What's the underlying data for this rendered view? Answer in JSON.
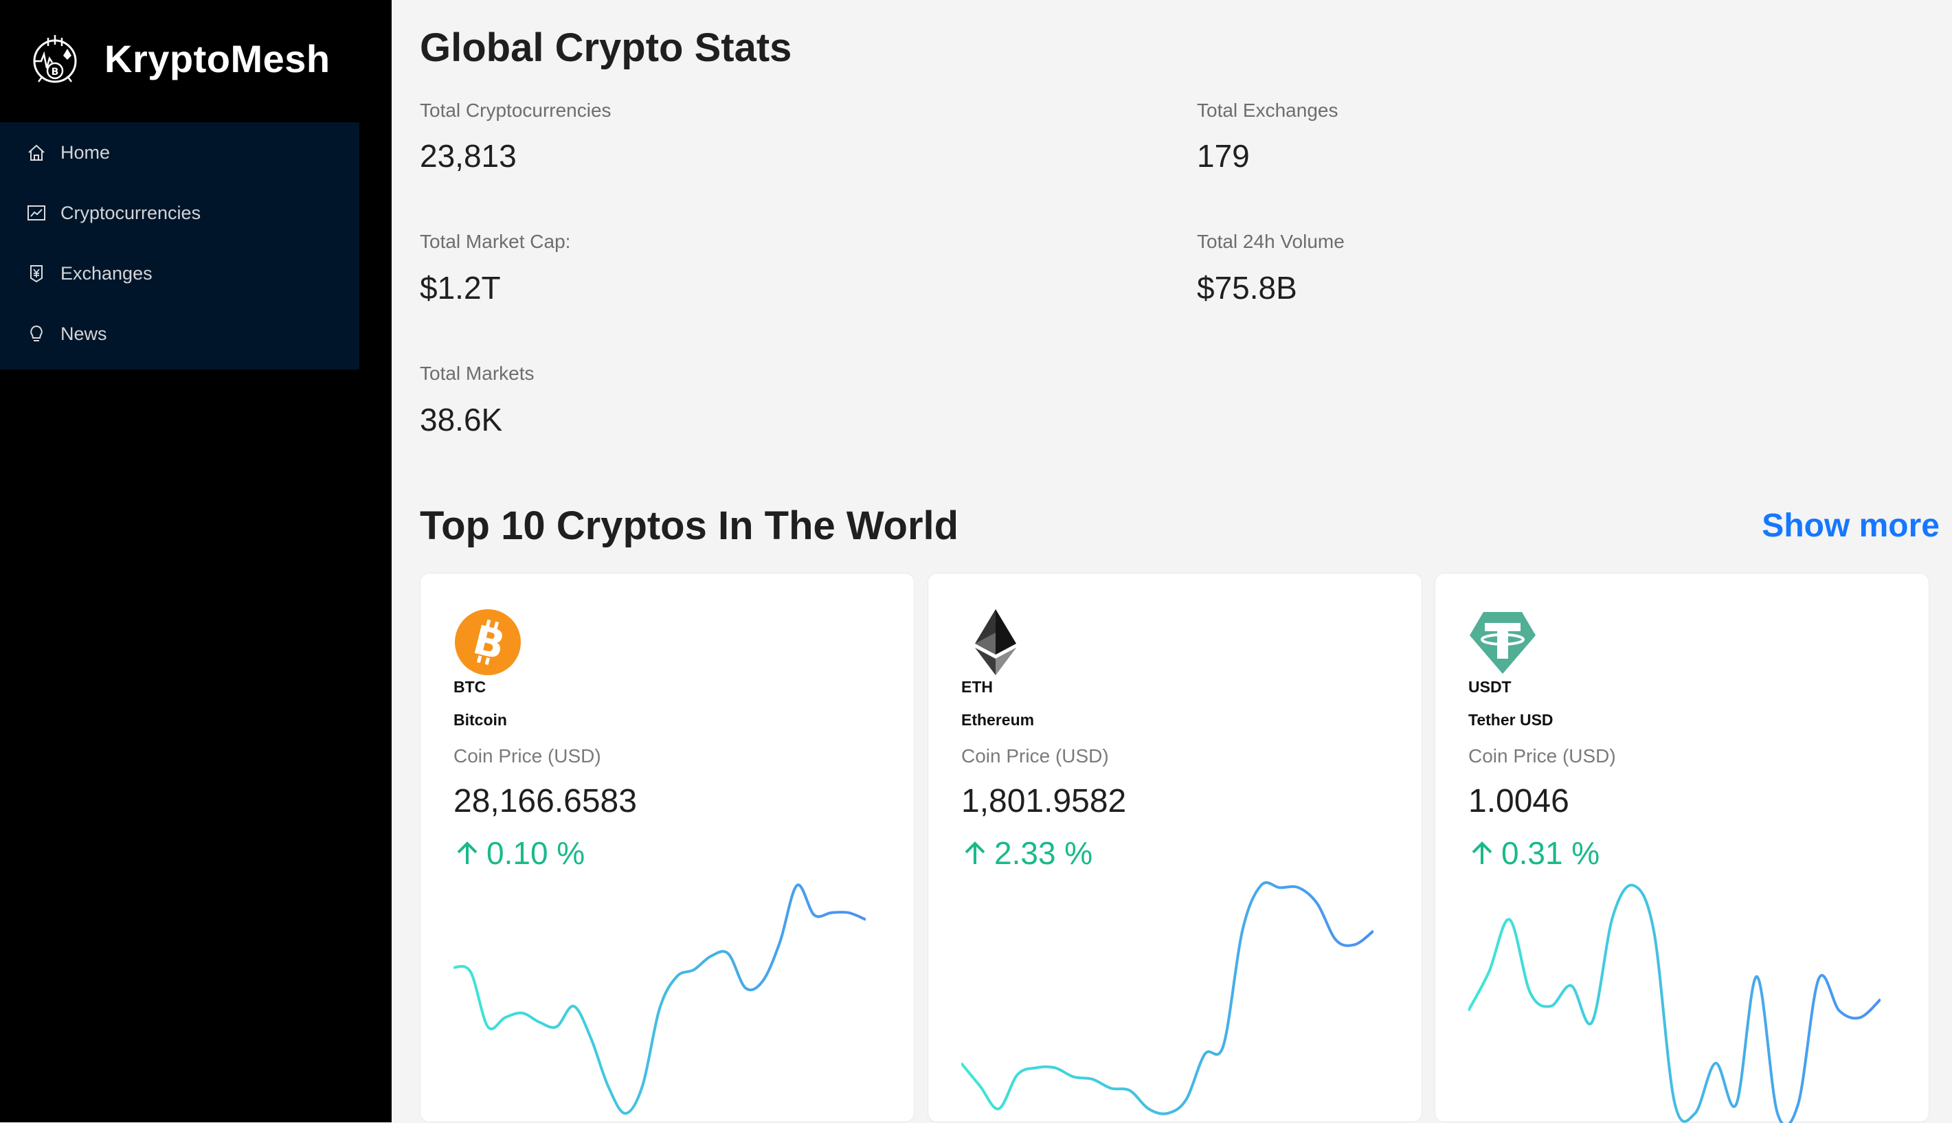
{
  "brand": {
    "name": "KryptoMesh",
    "logo_icon": "crypto-mesh-logo-icon"
  },
  "sidebar": {
    "items": [
      {
        "label": "Home",
        "icon": "home-icon"
      },
      {
        "label": "Cryptocurrencies",
        "icon": "line-chart-icon"
      },
      {
        "label": "Exchanges",
        "icon": "money-collect-icon"
      },
      {
        "label": "News",
        "icon": "bulb-icon"
      }
    ]
  },
  "stats": {
    "title": "Global Crypto Stats",
    "total_cryptocurrencies": {
      "label": "Total Cryptocurrencies",
      "value": "23,813"
    },
    "total_exchanges": {
      "label": "Total Exchanges",
      "value": "179"
    },
    "total_market_cap": {
      "label": "Total Market Cap:",
      "value": "$1.2T"
    },
    "total_24h_volume": {
      "label": "Total 24h Volume",
      "value": "$75.8B"
    },
    "total_markets": {
      "label": "Total Markets",
      "value": "38.6K"
    }
  },
  "top": {
    "title": "Top 10 Cryptos In The World",
    "show_more": "Show more",
    "coins": [
      {
        "symbol": "BTC",
        "name": "Bitcoin",
        "price_label": "Coin Price (USD)",
        "price": "28,166.6583",
        "change": "0.10 %",
        "icon": "bitcoin-icon",
        "sparkline": [
          0.64,
          0.62,
          0.38,
          0.42,
          0.44,
          0.4,
          0.38,
          0.47,
          0.33,
          0.12,
          0.0,
          0.12,
          0.46,
          0.6,
          0.63,
          0.69,
          0.7,
          0.55,
          0.58,
          0.75,
          1.0,
          0.87,
          0.88,
          0.88,
          0.85
        ]
      },
      {
        "symbol": "ETH",
        "name": "Ethereum",
        "price_label": "Coin Price (USD)",
        "price": "1,801.9582",
        "change": "2.33 %",
        "icon": "ethereum-icon",
        "sparkline": [
          0.22,
          0.12,
          0.02,
          0.17,
          0.2,
          0.2,
          0.16,
          0.15,
          0.11,
          0.1,
          0.02,
          0.0,
          0.06,
          0.26,
          0.3,
          0.8,
          1.0,
          0.99,
          0.99,
          0.92,
          0.76,
          0.74,
          0.8
        ]
      },
      {
        "symbol": "USDT",
        "name": "Tether USD",
        "price_label": "Coin Price (USD)",
        "price": "1.0046",
        "change": "0.31 %",
        "icon": "tether-icon",
        "sparkline": [
          0.45,
          0.62,
          0.85,
          0.53,
          0.47,
          0.56,
          0.4,
          0.86,
          1.0,
          0.8,
          0.05,
          0.0,
          0.22,
          0.04,
          0.6,
          0.0,
          0.04,
          0.59,
          0.45,
          0.42,
          0.5
        ]
      }
    ]
  },
  "colors": {
    "sidebar_bg": "#000000",
    "menu_bg": "#001529",
    "accent": "#1677ff",
    "positive": "#19b98b",
    "spark_start": "#3ee8d4",
    "spark_end": "#4a90f2",
    "btc": "#f7931a",
    "usdt": "#50af95"
  }
}
